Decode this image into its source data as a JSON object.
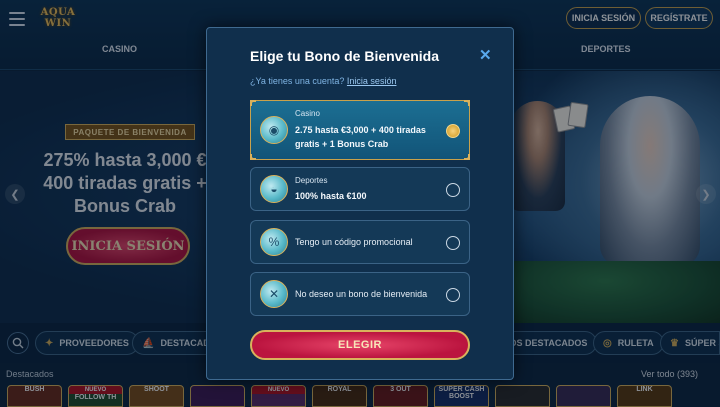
{
  "header": {
    "logo_line1": "AQUA",
    "logo_line2": "WIN",
    "login_label": "INICIA SESIÓN",
    "register_label": "REGÍSTRATE",
    "nav": {
      "casino": "CASINO",
      "deportes": "DEPORTES"
    }
  },
  "hero": {
    "package_tag": "PAQUETE DE BIENVENIDA",
    "line1": "275% hasta 3,000 €",
    "line2": "400 tiradas gratis +",
    "line3": "Bonus Crab",
    "cta": "INICIA SESIÓN"
  },
  "categories": {
    "items": [
      {
        "label": "PROVEEDORES",
        "icon": "crab-icon"
      },
      {
        "label": "DESTACADOS",
        "icon": "ship-icon"
      },
      {
        "label": "JUEGOS DESTACADOS",
        "icon": "star-icon"
      },
      {
        "label": "RULETA",
        "icon": "roulette-icon"
      },
      {
        "label": "SÚPER S",
        "icon": "slot-icon"
      }
    ]
  },
  "featured": {
    "title": "Destacados",
    "view_all": "Ver todo (393)",
    "thumbs": [
      {
        "title": "BUSH",
        "badge": "",
        "color": "#6b2a1b"
      },
      {
        "title": "FOLLOW TH",
        "badge": "NUEVO",
        "color": "#1f4d2b"
      },
      {
        "title": "SHOOT",
        "badge": "",
        "color": "#7a4d1a"
      },
      {
        "title": "",
        "badge": "",
        "color": "#3e1a55"
      },
      {
        "title": "",
        "badge": "NUEVO",
        "color": "#5a2a66"
      },
      {
        "title": "ROYAL",
        "badge": "",
        "color": "#4a2a10"
      },
      {
        "title": "3 OUT",
        "badge": "",
        "color": "#6b1a1a"
      },
      {
        "title": "SUPER CASH BOOST",
        "badge": "",
        "color": "#152f66"
      },
      {
        "title": "",
        "badge": "",
        "color": "#2a2a2a"
      },
      {
        "title": "",
        "badge": "",
        "color": "#3a2a55"
      },
      {
        "title": "LINK",
        "badge": "",
        "color": "#5a3a10"
      }
    ]
  },
  "modal": {
    "title": "Elige tu Bono de Bienvenida",
    "account_question": "¿Ya tienes una cuenta?",
    "login_link": "Inicia sesión",
    "options": [
      {
        "label": "Casino",
        "desc": "2.75 hasta €3,000 + 400 tiradas gratis + 1 Bonus Crab",
        "selected": true,
        "icon": "coins-icon"
      },
      {
        "label": "Deportes",
        "desc": "100% hasta €100",
        "selected": false,
        "icon": "volleyball-icon"
      },
      {
        "label": "",
        "desc": "Tengo un código promocional",
        "selected": false,
        "icon": "promo-tag-icon"
      },
      {
        "label": "",
        "desc": "No deseo un bono de bienvenida",
        "selected": false,
        "icon": "no-bonus-icon"
      }
    ],
    "submit_label": "ELEGIR"
  }
}
